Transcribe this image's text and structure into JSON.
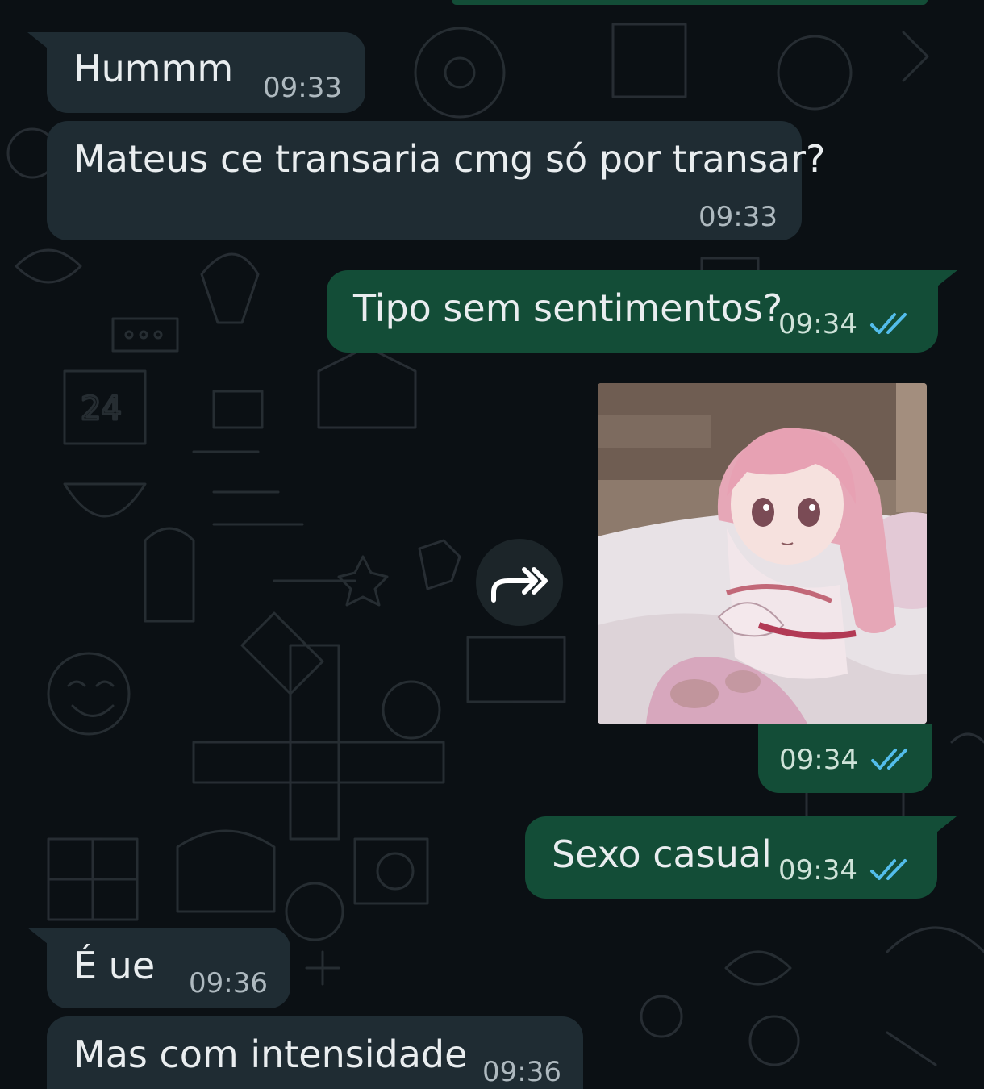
{
  "chat": {
    "messages": [
      {
        "direction": "incoming",
        "text": "Hummm",
        "time": "09:33"
      },
      {
        "direction": "incoming",
        "text": "Mateus ce transaria cmg só por transar?",
        "time": "09:33"
      },
      {
        "direction": "outgoing",
        "text": "Tipo sem sentimentos?",
        "time": "09:34",
        "status": "read"
      },
      {
        "direction": "outgoing",
        "type": "image",
        "time": "09:34",
        "status": "read"
      },
      {
        "direction": "outgoing",
        "text": "Sexo casual",
        "time": "09:34",
        "status": "read"
      },
      {
        "direction": "incoming",
        "text": "É ue",
        "time": "09:36"
      },
      {
        "direction": "incoming",
        "text": "Mas com intensidade",
        "time": "09:36"
      }
    ],
    "icons": {
      "read_receipt": "double-check-icon",
      "forward": "forward-icon"
    },
    "colors": {
      "background": "#0b1014",
      "incoming_bubble": "#1f2c33",
      "outgoing_bubble": "#134d37",
      "read_tick": "#53bdeb"
    }
  }
}
